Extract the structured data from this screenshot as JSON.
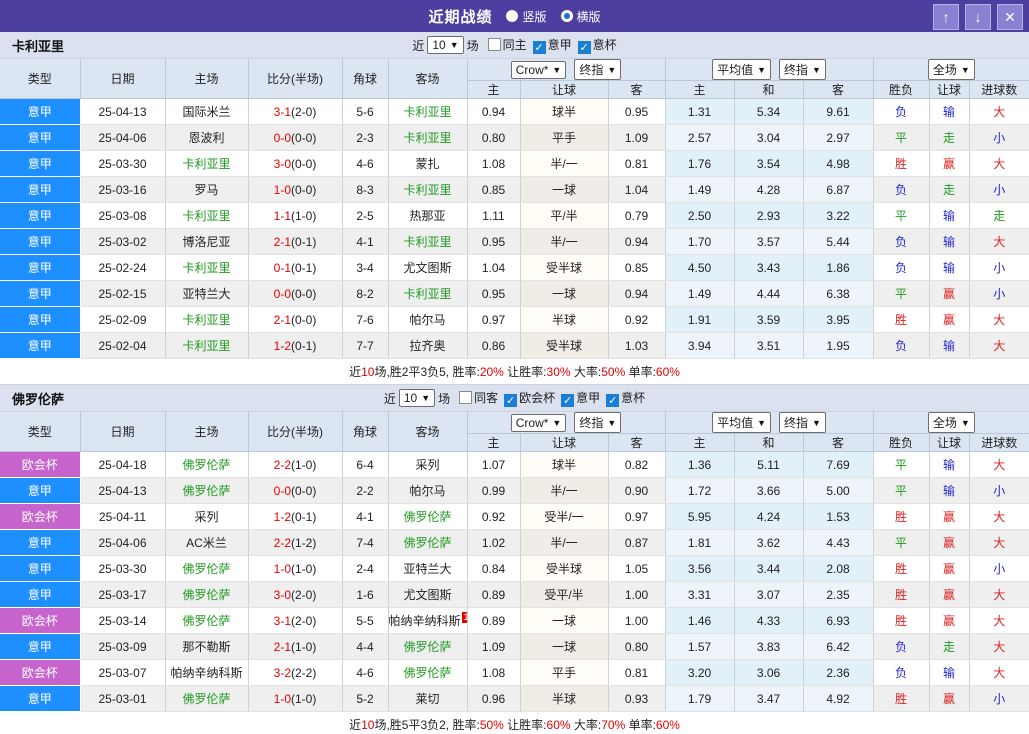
{
  "titlebar": {
    "title": "近期战绩",
    "radios": [
      {
        "label": "竖版",
        "selected": false
      },
      {
        "label": "横版",
        "selected": true
      }
    ],
    "buttons": {
      "up": "↑",
      "down": "↓",
      "close": "✕"
    }
  },
  "colors": {
    "titlebar_bg": "#4c3f9f",
    "serie_a_badge": "#1e8fff",
    "uecl_badge": "#c763cc",
    "team_highlight": "#1f9a1f",
    "score_red": "#e60000",
    "avg_col_bg": "#e2f0fa"
  },
  "header_labels": {
    "col_type": "类型",
    "col_date": "日期",
    "col_home": "主场",
    "col_score": "比分(半场)",
    "col_corner": "角球",
    "col_away": "客场",
    "dd_crow": "Crow*",
    "dd_final1": "终指",
    "dd_avg": "平均值",
    "dd_final2": "终指",
    "dd_scope": "全场",
    "sub": [
      "主",
      "让球",
      "客",
      "主",
      "和",
      "客",
      "胜负",
      "让球",
      "进球数"
    ]
  },
  "sections": [
    {
      "team": "卡利亚里",
      "controls": {
        "prefix": "近",
        "count": "10",
        "suffix": "场",
        "checks": [
          {
            "label": "同主",
            "checked": false
          },
          {
            "label": "意甲",
            "checked": true
          },
          {
            "label": "意杯",
            "checked": true
          }
        ]
      },
      "rows": [
        {
          "league": "意甲",
          "league_color": "blue",
          "date": "25-04-13",
          "home": "国际米兰",
          "home_hl": false,
          "score_ft": "3-1",
          "score_ht": "(2-0)",
          "corners": "5-6",
          "away": "卡利亚里",
          "away_hl": true,
          "odds_home": "0.94",
          "handicap": "球半",
          "odds_away": "0.95",
          "avg_home": "1.31",
          "avg_draw": "5.34",
          "avg_away": "9.61",
          "res": [
            [
              "负",
              "b"
            ],
            [
              "输",
              "b"
            ],
            [
              "大",
              "r"
            ]
          ]
        },
        {
          "league": "意甲",
          "league_color": "blue",
          "date": "25-04-06",
          "home": "恩波利",
          "home_hl": false,
          "score_ft": "0-0",
          "score_ht": "(0-0)",
          "corners": "2-3",
          "away": "卡利亚里",
          "away_hl": true,
          "odds_home": "0.80",
          "handicap": "平手",
          "odds_away": "1.09",
          "avg_home": "2.57",
          "avg_draw": "3.04",
          "avg_away": "2.97",
          "res": [
            [
              "平",
              "g"
            ],
            [
              "走",
              "g"
            ],
            [
              "小",
              "b"
            ]
          ]
        },
        {
          "league": "意甲",
          "league_color": "blue",
          "date": "25-03-30",
          "home": "卡利亚里",
          "home_hl": true,
          "score_ft": "3-0",
          "score_ht": "(0-0)",
          "corners": "4-6",
          "away": "蒙扎",
          "away_hl": false,
          "odds_home": "1.08",
          "handicap": "半/一",
          "odds_away": "0.81",
          "avg_home": "1.76",
          "avg_draw": "3.54",
          "avg_away": "4.98",
          "res": [
            [
              "胜",
              "r"
            ],
            [
              "赢",
              "r"
            ],
            [
              "大",
              "r"
            ]
          ]
        },
        {
          "league": "意甲",
          "league_color": "blue",
          "date": "25-03-16",
          "home": "罗马",
          "home_hl": false,
          "score_ft": "1-0",
          "score_ht": "(0-0)",
          "corners": "8-3",
          "away": "卡利亚里",
          "away_hl": true,
          "odds_home": "0.85",
          "handicap": "一球",
          "odds_away": "1.04",
          "avg_home": "1.49",
          "avg_draw": "4.28",
          "avg_away": "6.87",
          "res": [
            [
              "负",
              "b"
            ],
            [
              "走",
              "g"
            ],
            [
              "小",
              "b"
            ]
          ]
        },
        {
          "league": "意甲",
          "league_color": "blue",
          "date": "25-03-08",
          "home": "卡利亚里",
          "home_hl": true,
          "score_ft": "1-1",
          "score_ht": "(1-0)",
          "corners": "2-5",
          "away": "热那亚",
          "away_hl": false,
          "odds_home": "1.11",
          "handicap": "平/半",
          "odds_away": "0.79",
          "avg_home": "2.50",
          "avg_draw": "2.93",
          "avg_away": "3.22",
          "res": [
            [
              "平",
              "g"
            ],
            [
              "输",
              "b"
            ],
            [
              "走",
              "g"
            ]
          ]
        },
        {
          "league": "意甲",
          "league_color": "blue",
          "date": "25-03-02",
          "home": "博洛尼亚",
          "home_hl": false,
          "score_ft": "2-1",
          "score_ht": "(0-1)",
          "corners": "4-1",
          "away": "卡利亚里",
          "away_hl": true,
          "odds_home": "0.95",
          "handicap": "半/一",
          "odds_away": "0.94",
          "avg_home": "1.70",
          "avg_draw": "3.57",
          "avg_away": "5.44",
          "res": [
            [
              "负",
              "b"
            ],
            [
              "输",
              "b"
            ],
            [
              "大",
              "r"
            ]
          ]
        },
        {
          "league": "意甲",
          "league_color": "blue",
          "date": "25-02-24",
          "home": "卡利亚里",
          "home_hl": true,
          "score_ft": "0-1",
          "score_ht": "(0-1)",
          "corners": "3-4",
          "away": "尤文图斯",
          "away_hl": false,
          "odds_home": "1.04",
          "handicap": "受半球",
          "odds_away": "0.85",
          "avg_home": "4.50",
          "avg_draw": "3.43",
          "avg_away": "1.86",
          "res": [
            [
              "负",
              "b"
            ],
            [
              "输",
              "b"
            ],
            [
              "小",
              "b"
            ]
          ]
        },
        {
          "league": "意甲",
          "league_color": "blue",
          "date": "25-02-15",
          "home": "亚特兰大",
          "home_hl": false,
          "score_ft": "0-0",
          "score_ht": "(0-0)",
          "corners": "8-2",
          "away": "卡利亚里",
          "away_hl": true,
          "odds_home": "0.95",
          "handicap": "一球",
          "odds_away": "0.94",
          "avg_home": "1.49",
          "avg_draw": "4.44",
          "avg_away": "6.38",
          "res": [
            [
              "平",
              "g"
            ],
            [
              "赢",
              "r"
            ],
            [
              "小",
              "b"
            ]
          ]
        },
        {
          "league": "意甲",
          "league_color": "blue",
          "date": "25-02-09",
          "home": "卡利亚里",
          "home_hl": true,
          "score_ft": "2-1",
          "score_ht": "(0-0)",
          "corners": "7-6",
          "away": "帕尔马",
          "away_hl": false,
          "odds_home": "0.97",
          "handicap": "半球",
          "odds_away": "0.92",
          "avg_home": "1.91",
          "avg_draw": "3.59",
          "avg_away": "3.95",
          "res": [
            [
              "胜",
              "r"
            ],
            [
              "赢",
              "r"
            ],
            [
              "大",
              "r"
            ]
          ]
        },
        {
          "league": "意甲",
          "league_color": "blue",
          "date": "25-02-04",
          "home": "卡利亚里",
          "home_hl": true,
          "score_ft": "1-2",
          "score_ht": "(0-1)",
          "corners": "7-7",
          "away": "拉齐奥",
          "away_hl": false,
          "odds_home": "0.86",
          "handicap": "受半球",
          "odds_away": "1.03",
          "avg_home": "3.94",
          "avg_draw": "3.51",
          "avg_away": "1.95",
          "res": [
            [
              "负",
              "b"
            ],
            [
              "输",
              "b"
            ],
            [
              "大",
              "r"
            ]
          ]
        }
      ],
      "summary": [
        {
          "t": "近"
        },
        {
          "t": "10",
          "red": true
        },
        {
          "t": "场,胜2平3负5, 胜率:"
        },
        {
          "t": "20%",
          "red": true
        },
        {
          "t": " 让胜率:"
        },
        {
          "t": "30%",
          "red": true
        },
        {
          "t": " 大率:"
        },
        {
          "t": "50%",
          "red": true
        },
        {
          "t": " 单率:"
        },
        {
          "t": "60%",
          "red": true
        }
      ]
    },
    {
      "team": "佛罗伦萨",
      "controls": {
        "prefix": "近",
        "count": "10",
        "suffix": "场",
        "checks": [
          {
            "label": "同客",
            "checked": false
          },
          {
            "label": "欧会杯",
            "checked": true
          },
          {
            "label": "意甲",
            "checked": true
          },
          {
            "label": "意杯",
            "checked": true
          }
        ]
      },
      "rows": [
        {
          "league": "欧会杯",
          "league_color": "purple",
          "date": "25-04-18",
          "home": "佛罗伦萨",
          "home_hl": true,
          "score_ft": "2-2",
          "score_ht": "(1-0)",
          "corners": "6-4",
          "away": "采列",
          "away_hl": false,
          "odds_home": "1.07",
          "handicap": "球半",
          "odds_away": "0.82",
          "avg_home": "1.36",
          "avg_draw": "5.11",
          "avg_away": "7.69",
          "res": [
            [
              "平",
              "g"
            ],
            [
              "输",
              "b"
            ],
            [
              "大",
              "r"
            ]
          ]
        },
        {
          "league": "意甲",
          "league_color": "blue",
          "date": "25-04-13",
          "home": "佛罗伦萨",
          "home_hl": true,
          "score_ft": "0-0",
          "score_ht": "(0-0)",
          "corners": "2-2",
          "away": "帕尔马",
          "away_hl": false,
          "odds_home": "0.99",
          "handicap": "半/一",
          "odds_away": "0.90",
          "avg_home": "1.72",
          "avg_draw": "3.66",
          "avg_away": "5.00",
          "res": [
            [
              "平",
              "g"
            ],
            [
              "输",
              "b"
            ],
            [
              "小",
              "b"
            ]
          ]
        },
        {
          "league": "欧会杯",
          "league_color": "purple",
          "date": "25-04-11",
          "home": "采列",
          "home_hl": false,
          "score_ft": "1-2",
          "score_ht": "(0-1)",
          "corners": "4-1",
          "away": "佛罗伦萨",
          "away_hl": true,
          "odds_home": "0.92",
          "handicap": "受半/一",
          "odds_away": "0.97",
          "avg_home": "5.95",
          "avg_draw": "4.24",
          "avg_away": "1.53",
          "res": [
            [
              "胜",
              "r"
            ],
            [
              "赢",
              "r"
            ],
            [
              "大",
              "r"
            ]
          ]
        },
        {
          "league": "意甲",
          "league_color": "blue",
          "date": "25-04-06",
          "home": "AC米兰",
          "home_hl": false,
          "score_ft": "2-2",
          "score_ht": "(1-2)",
          "corners": "7-4",
          "away": "佛罗伦萨",
          "away_hl": true,
          "odds_home": "1.02",
          "handicap": "半/一",
          "odds_away": "0.87",
          "avg_home": "1.81",
          "avg_draw": "3.62",
          "avg_away": "4.43",
          "res": [
            [
              "平",
              "g"
            ],
            [
              "赢",
              "r"
            ],
            [
              "大",
              "r"
            ]
          ]
        },
        {
          "league": "意甲",
          "league_color": "blue",
          "date": "25-03-30",
          "home": "佛罗伦萨",
          "home_hl": true,
          "score_ft": "1-0",
          "score_ht": "(1-0)",
          "corners": "2-4",
          "away": "亚特兰大",
          "away_hl": false,
          "odds_home": "0.84",
          "handicap": "受半球",
          "odds_away": "1.05",
          "avg_home": "3.56",
          "avg_draw": "3.44",
          "avg_away": "2.08",
          "res": [
            [
              "胜",
              "r"
            ],
            [
              "赢",
              "r"
            ],
            [
              "小",
              "b"
            ]
          ]
        },
        {
          "league": "意甲",
          "league_color": "blue",
          "date": "25-03-17",
          "home": "佛罗伦萨",
          "home_hl": true,
          "score_ft": "3-0",
          "score_ht": "(2-0)",
          "corners": "1-6",
          "away": "尤文图斯",
          "away_hl": false,
          "odds_home": "0.89",
          "handicap": "受平/半",
          "odds_away": "1.00",
          "avg_home": "3.31",
          "avg_draw": "3.07",
          "avg_away": "2.35",
          "res": [
            [
              "胜",
              "r"
            ],
            [
              "赢",
              "r"
            ],
            [
              "大",
              "r"
            ]
          ]
        },
        {
          "league": "欧会杯",
          "league_color": "purple",
          "date": "25-03-14",
          "home": "佛罗伦萨",
          "home_hl": true,
          "score_ft": "3-1",
          "score_ht": "(2-0)",
          "corners": "5-5",
          "away": "帕纳辛纳科斯",
          "away_hl": false,
          "away_badge": "1",
          "odds_home": "0.89",
          "handicap": "一球",
          "odds_away": "1.00",
          "avg_home": "1.46",
          "avg_draw": "4.33",
          "avg_away": "6.93",
          "res": [
            [
              "胜",
              "r"
            ],
            [
              "赢",
              "r"
            ],
            [
              "大",
              "r"
            ]
          ]
        },
        {
          "league": "意甲",
          "league_color": "blue",
          "date": "25-03-09",
          "home": "那不勒斯",
          "home_hl": false,
          "score_ft": "2-1",
          "score_ht": "(1-0)",
          "corners": "4-4",
          "away": "佛罗伦萨",
          "away_hl": true,
          "odds_home": "1.09",
          "handicap": "一球",
          "odds_away": "0.80",
          "avg_home": "1.57",
          "avg_draw": "3.83",
          "avg_away": "6.42",
          "res": [
            [
              "负",
              "b"
            ],
            [
              "走",
              "g"
            ],
            [
              "大",
              "r"
            ]
          ]
        },
        {
          "league": "欧会杯",
          "league_color": "purple",
          "date": "25-03-07",
          "home": "帕纳辛纳科斯",
          "home_hl": false,
          "score_ft": "3-2",
          "score_ht": "(2-2)",
          "corners": "4-6",
          "away": "佛罗伦萨",
          "away_hl": true,
          "odds_home": "1.08",
          "handicap": "平手",
          "odds_away": "0.81",
          "avg_home": "3.20",
          "avg_draw": "3.06",
          "avg_away": "2.36",
          "res": [
            [
              "负",
              "b"
            ],
            [
              "输",
              "b"
            ],
            [
              "大",
              "r"
            ]
          ]
        },
        {
          "league": "意甲",
          "league_color": "blue",
          "date": "25-03-01",
          "home": "佛罗伦萨",
          "home_hl": true,
          "score_ft": "1-0",
          "score_ht": "(1-0)",
          "corners": "5-2",
          "away": "莱切",
          "away_hl": false,
          "odds_home": "0.96",
          "handicap": "半球",
          "odds_away": "0.93",
          "avg_home": "1.79",
          "avg_draw": "3.47",
          "avg_away": "4.92",
          "res": [
            [
              "胜",
              "r"
            ],
            [
              "赢",
              "r"
            ],
            [
              "小",
              "b"
            ]
          ]
        }
      ],
      "summary": [
        {
          "t": "近"
        },
        {
          "t": "10",
          "red": true
        },
        {
          "t": "场,胜5平3负2, 胜率:"
        },
        {
          "t": "50%",
          "red": true
        },
        {
          "t": " 让胜率:"
        },
        {
          "t": "60%",
          "red": true
        },
        {
          "t": " 大率:"
        },
        {
          "t": "70%",
          "red": true
        },
        {
          "t": " 单率:"
        },
        {
          "t": "60%",
          "red": true
        }
      ]
    }
  ]
}
